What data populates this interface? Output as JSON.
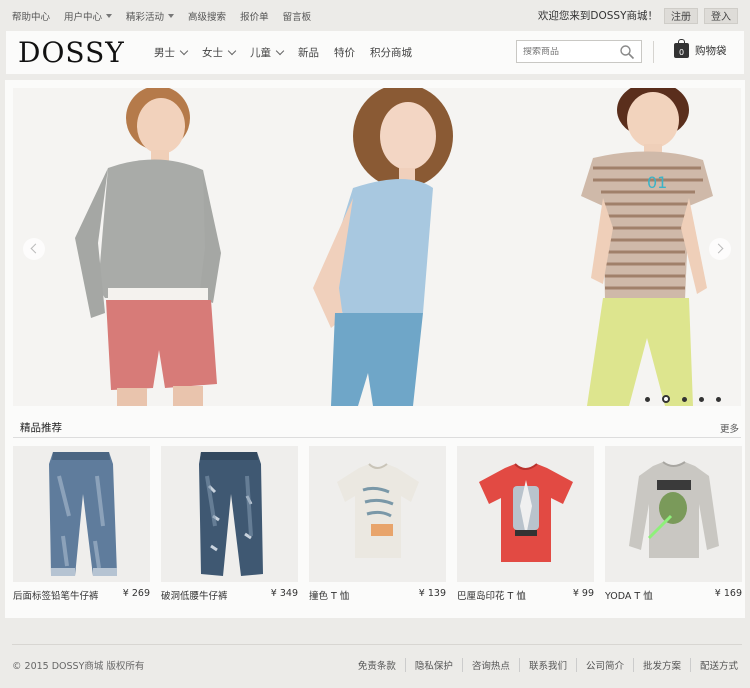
{
  "topbar": {
    "links": [
      {
        "label": "帮助中心",
        "caret": false
      },
      {
        "label": "用户中心",
        "caret": true
      },
      {
        "label": "精彩活动",
        "caret": true
      },
      {
        "label": "高级搜索",
        "caret": false
      },
      {
        "label": "报价单",
        "caret": false
      },
      {
        "label": "留言板",
        "caret": false
      }
    ],
    "welcome": "欢迎您来到DOSSY商城！",
    "register_label": "注册",
    "login_label": "登入"
  },
  "header": {
    "logo": "DOSSY",
    "nav": [
      {
        "label": "男士",
        "dropdown": true
      },
      {
        "label": "女士",
        "dropdown": true
      },
      {
        "label": "儿童",
        "dropdown": true
      },
      {
        "label": "新品",
        "dropdown": false
      },
      {
        "label": "特价",
        "dropdown": false
      },
      {
        "label": "积分商城",
        "dropdown": false
      }
    ],
    "search_placeholder": "搜索商品",
    "cart_count": "0",
    "cart_label": "购物袋"
  },
  "banner": {
    "slide_count": 5,
    "active_slide": 2
  },
  "featured": {
    "title": "精品推荐",
    "more_label": "更多",
    "products": [
      {
        "name": "后面标签铅笔牛仔裤",
        "price": "¥ 269",
        "icon": "jeans-light"
      },
      {
        "name": "破洞低腰牛仔裤",
        "price": "¥ 349",
        "icon": "jeans-dark"
      },
      {
        "name": "撞色 T 恤",
        "price": "¥ 139",
        "icon": "tshirt-white"
      },
      {
        "name": "巴厘岛印花 T 恤",
        "price": "¥ 99",
        "icon": "tshirt-red"
      },
      {
        "name": "YODA T 恤",
        "price": "¥ 169",
        "icon": "longsleeve-grey"
      }
    ]
  },
  "footer": {
    "copyright": "© 2015 DOSSY商城 版权所有",
    "links": [
      "免责条款",
      "隐私保护",
      "咨询热点",
      "联系我们",
      "公司简介",
      "批发方案",
      "配送方式"
    ]
  },
  "colors": {
    "page_bg": "#ecebe8",
    "card_bg": "#fbfbfa",
    "banner_bg": "#f5f4f2"
  }
}
